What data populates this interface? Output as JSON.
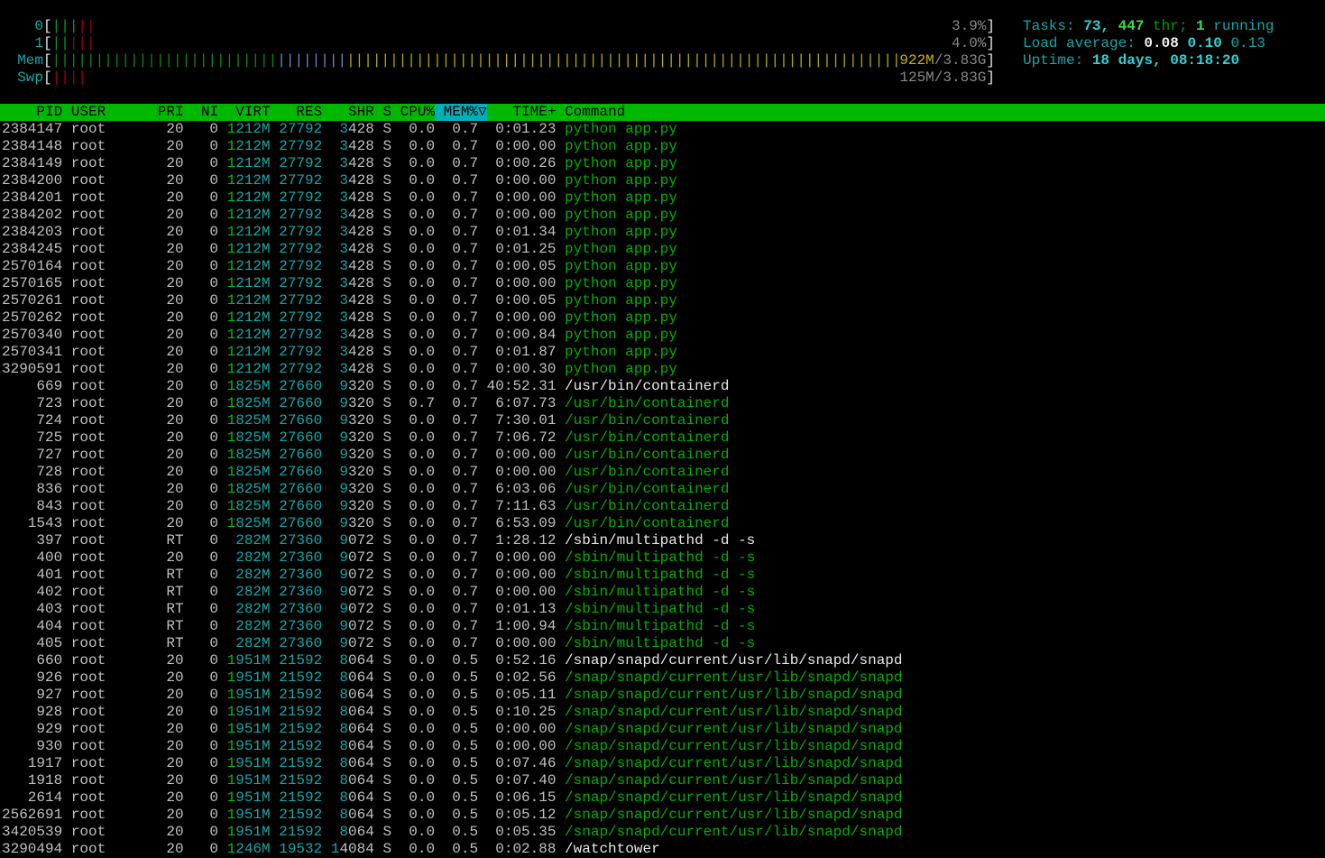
{
  "meters": [
    {
      "label": "0",
      "value": "3.9%",
      "segments": {
        "normal": 3,
        "kernel": 2
      }
    },
    {
      "label": "1",
      "value": "4.0%",
      "segments": {
        "normal": 2,
        "kernel": 3
      }
    },
    {
      "label": "Mem",
      "value_used": "922M",
      "value_total": "/3.83G",
      "segments": {
        "used": 26,
        "buffers": 8,
        "cache": 64
      }
    },
    {
      "label": "Swp",
      "value": "125M/3.83G",
      "segments": {
        "used": 4
      }
    }
  ],
  "info": {
    "tasks_label": "Tasks: ",
    "tasks": "73",
    "sep": ", ",
    "threads": "447",
    "thr_label": " thr; ",
    "running": "1",
    "running_label": " running",
    "load_label": "Load average: ",
    "load1": "0.08",
    "load5": "0.10",
    "load15": "0.13",
    "uptime_label": "Uptime: ",
    "uptime": "18 days, 08:18:20"
  },
  "columns": [
    "PID",
    "USER",
    "PRI",
    "NI",
    "VIRT",
    "RES",
    "SHR",
    "S",
    "CPU%",
    "MEM%▽",
    "TIME+",
    "Command"
  ],
  "sort_column": "MEM%▽",
  "processes": [
    [
      "2384147",
      "root",
      "20",
      "0",
      "1212M",
      "27792",
      "3428",
      "S",
      "0.0",
      "0.7",
      "0:01.23",
      "python app.py",
      1
    ],
    [
      "2384148",
      "root",
      "20",
      "0",
      "1212M",
      "27792",
      "3428",
      "S",
      "0.0",
      "0.7",
      "0:00.00",
      "python app.py",
      1
    ],
    [
      "2384149",
      "root",
      "20",
      "0",
      "1212M",
      "27792",
      "3428",
      "S",
      "0.0",
      "0.7",
      "0:00.26",
      "python app.py",
      1
    ],
    [
      "2384200",
      "root",
      "20",
      "0",
      "1212M",
      "27792",
      "3428",
      "S",
      "0.0",
      "0.7",
      "0:00.00",
      "python app.py",
      1
    ],
    [
      "2384201",
      "root",
      "20",
      "0",
      "1212M",
      "27792",
      "3428",
      "S",
      "0.0",
      "0.7",
      "0:00.00",
      "python app.py",
      1
    ],
    [
      "2384202",
      "root",
      "20",
      "0",
      "1212M",
      "27792",
      "3428",
      "S",
      "0.0",
      "0.7",
      "0:00.00",
      "python app.py",
      1
    ],
    [
      "2384203",
      "root",
      "20",
      "0",
      "1212M",
      "27792",
      "3428",
      "S",
      "0.0",
      "0.7",
      "0:01.34",
      "python app.py",
      1
    ],
    [
      "2384245",
      "root",
      "20",
      "0",
      "1212M",
      "27792",
      "3428",
      "S",
      "0.0",
      "0.7",
      "0:01.25",
      "python app.py",
      1
    ],
    [
      "2570164",
      "root",
      "20",
      "0",
      "1212M",
      "27792",
      "3428",
      "S",
      "0.0",
      "0.7",
      "0:00.05",
      "python app.py",
      1
    ],
    [
      "2570165",
      "root",
      "20",
      "0",
      "1212M",
      "27792",
      "3428",
      "S",
      "0.0",
      "0.7",
      "0:00.00",
      "python app.py",
      1
    ],
    [
      "2570261",
      "root",
      "20",
      "0",
      "1212M",
      "27792",
      "3428",
      "S",
      "0.0",
      "0.7",
      "0:00.05",
      "python app.py",
      1
    ],
    [
      "2570262",
      "root",
      "20",
      "0",
      "1212M",
      "27792",
      "3428",
      "S",
      "0.0",
      "0.7",
      "0:00.00",
      "python app.py",
      1
    ],
    [
      "2570340",
      "root",
      "20",
      "0",
      "1212M",
      "27792",
      "3428",
      "S",
      "0.0",
      "0.7",
      "0:00.84",
      "python app.py",
      1
    ],
    [
      "2570341",
      "root",
      "20",
      "0",
      "1212M",
      "27792",
      "3428",
      "S",
      "0.0",
      "0.7",
      "0:01.87",
      "python app.py",
      1
    ],
    [
      "3290591",
      "root",
      "20",
      "0",
      "1212M",
      "27792",
      "3428",
      "S",
      "0.0",
      "0.7",
      "0:00.30",
      "python app.py",
      1
    ],
    [
      "669",
      "root",
      "20",
      "0",
      "1825M",
      "27660",
      "9320",
      "S",
      "0.0",
      "0.7",
      "40:52.31",
      "/usr/bin/containerd",
      0
    ],
    [
      "723",
      "root",
      "20",
      "0",
      "1825M",
      "27660",
      "9320",
      "S",
      "0.7",
      "0.7",
      "6:07.73",
      "/usr/bin/containerd",
      1
    ],
    [
      "724",
      "root",
      "20",
      "0",
      "1825M",
      "27660",
      "9320",
      "S",
      "0.0",
      "0.7",
      "7:30.01",
      "/usr/bin/containerd",
      1
    ],
    [
      "725",
      "root",
      "20",
      "0",
      "1825M",
      "27660",
      "9320",
      "S",
      "0.0",
      "0.7",
      "7:06.72",
      "/usr/bin/containerd",
      1
    ],
    [
      "727",
      "root",
      "20",
      "0",
      "1825M",
      "27660",
      "9320",
      "S",
      "0.0",
      "0.7",
      "0:00.00",
      "/usr/bin/containerd",
      1
    ],
    [
      "728",
      "root",
      "20",
      "0",
      "1825M",
      "27660",
      "9320",
      "S",
      "0.0",
      "0.7",
      "0:00.00",
      "/usr/bin/containerd",
      1
    ],
    [
      "836",
      "root",
      "20",
      "0",
      "1825M",
      "27660",
      "9320",
      "S",
      "0.0",
      "0.7",
      "6:03.06",
      "/usr/bin/containerd",
      1
    ],
    [
      "843",
      "root",
      "20",
      "0",
      "1825M",
      "27660",
      "9320",
      "S",
      "0.0",
      "0.7",
      "7:11.63",
      "/usr/bin/containerd",
      1
    ],
    [
      "1543",
      "root",
      "20",
      "0",
      "1825M",
      "27660",
      "9320",
      "S",
      "0.0",
      "0.7",
      "6:53.09",
      "/usr/bin/containerd",
      1
    ],
    [
      "397",
      "root",
      "RT",
      "0",
      "282M",
      "27360",
      "9072",
      "S",
      "0.0",
      "0.7",
      "1:28.12",
      "/sbin/multipathd -d -s",
      0
    ],
    [
      "400",
      "root",
      "20",
      "0",
      "282M",
      "27360",
      "9072",
      "S",
      "0.0",
      "0.7",
      "0:00.00",
      "/sbin/multipathd -d -s",
      1
    ],
    [
      "401",
      "root",
      "RT",
      "0",
      "282M",
      "27360",
      "9072",
      "S",
      "0.0",
      "0.7",
      "0:00.00",
      "/sbin/multipathd -d -s",
      1
    ],
    [
      "402",
      "root",
      "RT",
      "0",
      "282M",
      "27360",
      "9072",
      "S",
      "0.0",
      "0.7",
      "0:00.00",
      "/sbin/multipathd -d -s",
      1
    ],
    [
      "403",
      "root",
      "RT",
      "0",
      "282M",
      "27360",
      "9072",
      "S",
      "0.0",
      "0.7",
      "0:01.13",
      "/sbin/multipathd -d -s",
      1
    ],
    [
      "404",
      "root",
      "RT",
      "0",
      "282M",
      "27360",
      "9072",
      "S",
      "0.0",
      "0.7",
      "1:00.94",
      "/sbin/multipathd -d -s",
      1
    ],
    [
      "405",
      "root",
      "RT",
      "0",
      "282M",
      "27360",
      "9072",
      "S",
      "0.0",
      "0.7",
      "0:00.00",
      "/sbin/multipathd -d -s",
      1
    ],
    [
      "660",
      "root",
      "20",
      "0",
      "1951M",
      "21592",
      "8064",
      "S",
      "0.0",
      "0.5",
      "0:52.16",
      "/snap/snapd/current/usr/lib/snapd/snapd",
      0
    ],
    [
      "926",
      "root",
      "20",
      "0",
      "1951M",
      "21592",
      "8064",
      "S",
      "0.0",
      "0.5",
      "0:02.56",
      "/snap/snapd/current/usr/lib/snapd/snapd",
      1
    ],
    [
      "927",
      "root",
      "20",
      "0",
      "1951M",
      "21592",
      "8064",
      "S",
      "0.0",
      "0.5",
      "0:05.11",
      "/snap/snapd/current/usr/lib/snapd/snapd",
      1
    ],
    [
      "928",
      "root",
      "20",
      "0",
      "1951M",
      "21592",
      "8064",
      "S",
      "0.0",
      "0.5",
      "0:10.25",
      "/snap/snapd/current/usr/lib/snapd/snapd",
      1
    ],
    [
      "929",
      "root",
      "20",
      "0",
      "1951M",
      "21592",
      "8064",
      "S",
      "0.0",
      "0.5",
      "0:00.00",
      "/snap/snapd/current/usr/lib/snapd/snapd",
      1
    ],
    [
      "930",
      "root",
      "20",
      "0",
      "1951M",
      "21592",
      "8064",
      "S",
      "0.0",
      "0.5",
      "0:00.00",
      "/snap/snapd/current/usr/lib/snapd/snapd",
      1
    ],
    [
      "1917",
      "root",
      "20",
      "0",
      "1951M",
      "21592",
      "8064",
      "S",
      "0.0",
      "0.5",
      "0:07.46",
      "/snap/snapd/current/usr/lib/snapd/snapd",
      1
    ],
    [
      "1918",
      "root",
      "20",
      "0",
      "1951M",
      "21592",
      "8064",
      "S",
      "0.0",
      "0.5",
      "0:07.40",
      "/snap/snapd/current/usr/lib/snapd/snapd",
      1
    ],
    [
      "2614",
      "root",
      "20",
      "0",
      "1951M",
      "21592",
      "8064",
      "S",
      "0.0",
      "0.5",
      "0:06.15",
      "/snap/snapd/current/usr/lib/snapd/snapd",
      1
    ],
    [
      "2562691",
      "root",
      "20",
      "0",
      "1951M",
      "21592",
      "8064",
      "S",
      "0.0",
      "0.5",
      "0:05.12",
      "/snap/snapd/current/usr/lib/snapd/snapd",
      1
    ],
    [
      "3420539",
      "root",
      "20",
      "0",
      "1951M",
      "21592",
      "8064",
      "S",
      "0.0",
      "0.5",
      "0:05.35",
      "/snap/snapd/current/usr/lib/snapd/snapd",
      1
    ],
    [
      "3290494",
      "root",
      "20",
      "0",
      "1246M",
      "19532",
      "14084",
      "S",
      "0.0",
      "0.5",
      "0:02.88",
      "/watchtower",
      0
    ]
  ],
  "colors": {
    "normal": "#00a000",
    "kernel": "#a00000",
    "used": "#0a8a0a",
    "buffers": "#6a8cc8",
    "cache": "#b5a800",
    "swap": "#a00000"
  }
}
